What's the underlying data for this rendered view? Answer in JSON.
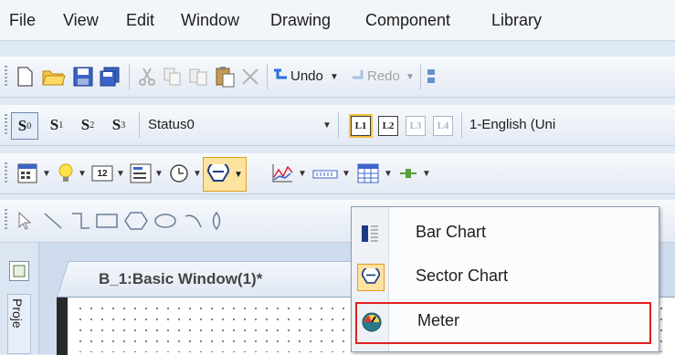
{
  "menubar": {
    "items": [
      "File",
      "View",
      "Edit",
      "Window",
      "Drawing",
      "Component",
      "Library"
    ]
  },
  "standard_toolbar": {
    "undo_label": "Undo",
    "redo_label": "Redo"
  },
  "status_toolbar": {
    "state_buttons": [
      "S",
      "S",
      "S",
      "S"
    ],
    "state_subscripts": [
      "0",
      "1",
      "2",
      "3"
    ],
    "status_value": "Status0",
    "language_buttons": [
      "L1",
      "L2",
      "L3",
      "L4"
    ],
    "language_value": "1-English (Uni"
  },
  "component_toolbar": {
    "numeric_icon_text": "12"
  },
  "tabs": {
    "window_tab": "B_1:Basic Window(1)*",
    "side_panel": "Proje"
  },
  "dropdown": {
    "items": [
      {
        "label": "Bar Chart",
        "icon": "bar-chart-icon"
      },
      {
        "label": "Sector Chart",
        "icon": "sector-chart-icon"
      },
      {
        "label": "Meter",
        "icon": "meter-icon"
      }
    ],
    "highlight_color": "#e02020"
  }
}
